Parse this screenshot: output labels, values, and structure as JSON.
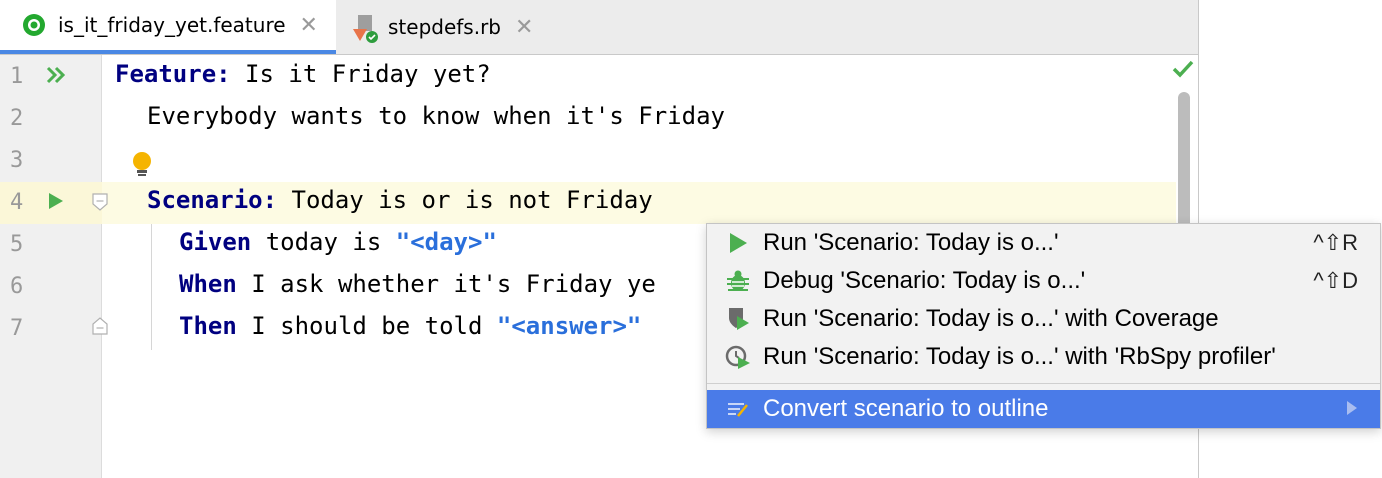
{
  "tabs": [
    {
      "label": "is_it_friday_yet.feature",
      "icon": "cucumber-icon",
      "active": true
    },
    {
      "label": "stepdefs.rb",
      "icon": "ruby-file-icon",
      "active": false
    }
  ],
  "gutter": {
    "line_numbers": [
      "1",
      "2",
      "3",
      "4",
      "5",
      "6",
      "7"
    ]
  },
  "code": {
    "line1": {
      "keyword": "Feature:",
      "text": " Is it Friday yet?"
    },
    "line2": {
      "text": "Everybody wants to know when it's Friday"
    },
    "line4": {
      "keyword": "Scenario:",
      "text": " Today is or is not Friday"
    },
    "line5": {
      "keyword": "Given",
      "text": " today is ",
      "string": "\"<day>\""
    },
    "line6": {
      "keyword": "When",
      "text": " I ask whether it's Friday ye"
    },
    "line7": {
      "keyword": "Then",
      "text": " I should be told ",
      "string": "\"<answer>\""
    }
  },
  "popup": {
    "items": [
      {
        "label": "Run 'Scenario: Today is o...'",
        "shortcut": "^⇧R",
        "icon": "run-icon"
      },
      {
        "label": "Debug 'Scenario: Today is o...'",
        "shortcut": "^⇧D",
        "icon": "debug-icon"
      },
      {
        "label": "Run 'Scenario: Today is o...' with Coverage",
        "shortcut": "",
        "icon": "coverage-icon"
      },
      {
        "label": "Run 'Scenario: Today is o...' with 'RbSpy profiler'",
        "shortcut": "",
        "icon": "profiler-icon"
      },
      {
        "label": "Convert scenario to outline",
        "shortcut": "",
        "icon": "convert-icon"
      }
    ]
  },
  "colors": {
    "accent": "#4a7be8",
    "run_green": "#4caf50",
    "keyword": "#000080",
    "string": "#2a6fdb",
    "highlight_line": "#fdfbe3"
  }
}
